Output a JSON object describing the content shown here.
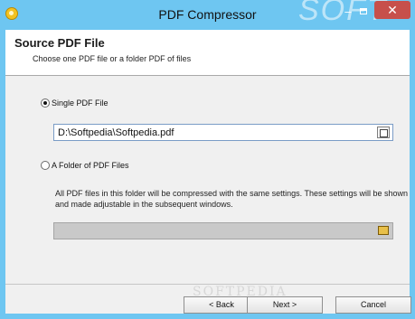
{
  "window": {
    "title": "PDF Compressor",
    "watermark_top": "SOFT",
    "close_label": "✕",
    "minimize_label": "–"
  },
  "header": {
    "title": "Source PDF File",
    "subtitle": "Choose one PDF file or a folder PDF of files"
  },
  "options": {
    "single_label": "Single PDF File",
    "single_selected": true,
    "file_path": "D:\\Softpedia\\Softpedia.pdf",
    "folder_label": "A Folder of PDF Files",
    "folder_selected": false,
    "folder_description": "All PDF files in this folder will be compressed with the same settings. These settings will be shown and made adjustable in the subsequent windows.",
    "folder_path": ""
  },
  "buttons": {
    "back": "< Back",
    "next": "Next >",
    "cancel": "Cancel"
  },
  "watermark": "SOFTPEDIA",
  "colors": {
    "titlebar": "#6ec6f1",
    "close_button": "#c7504b"
  }
}
